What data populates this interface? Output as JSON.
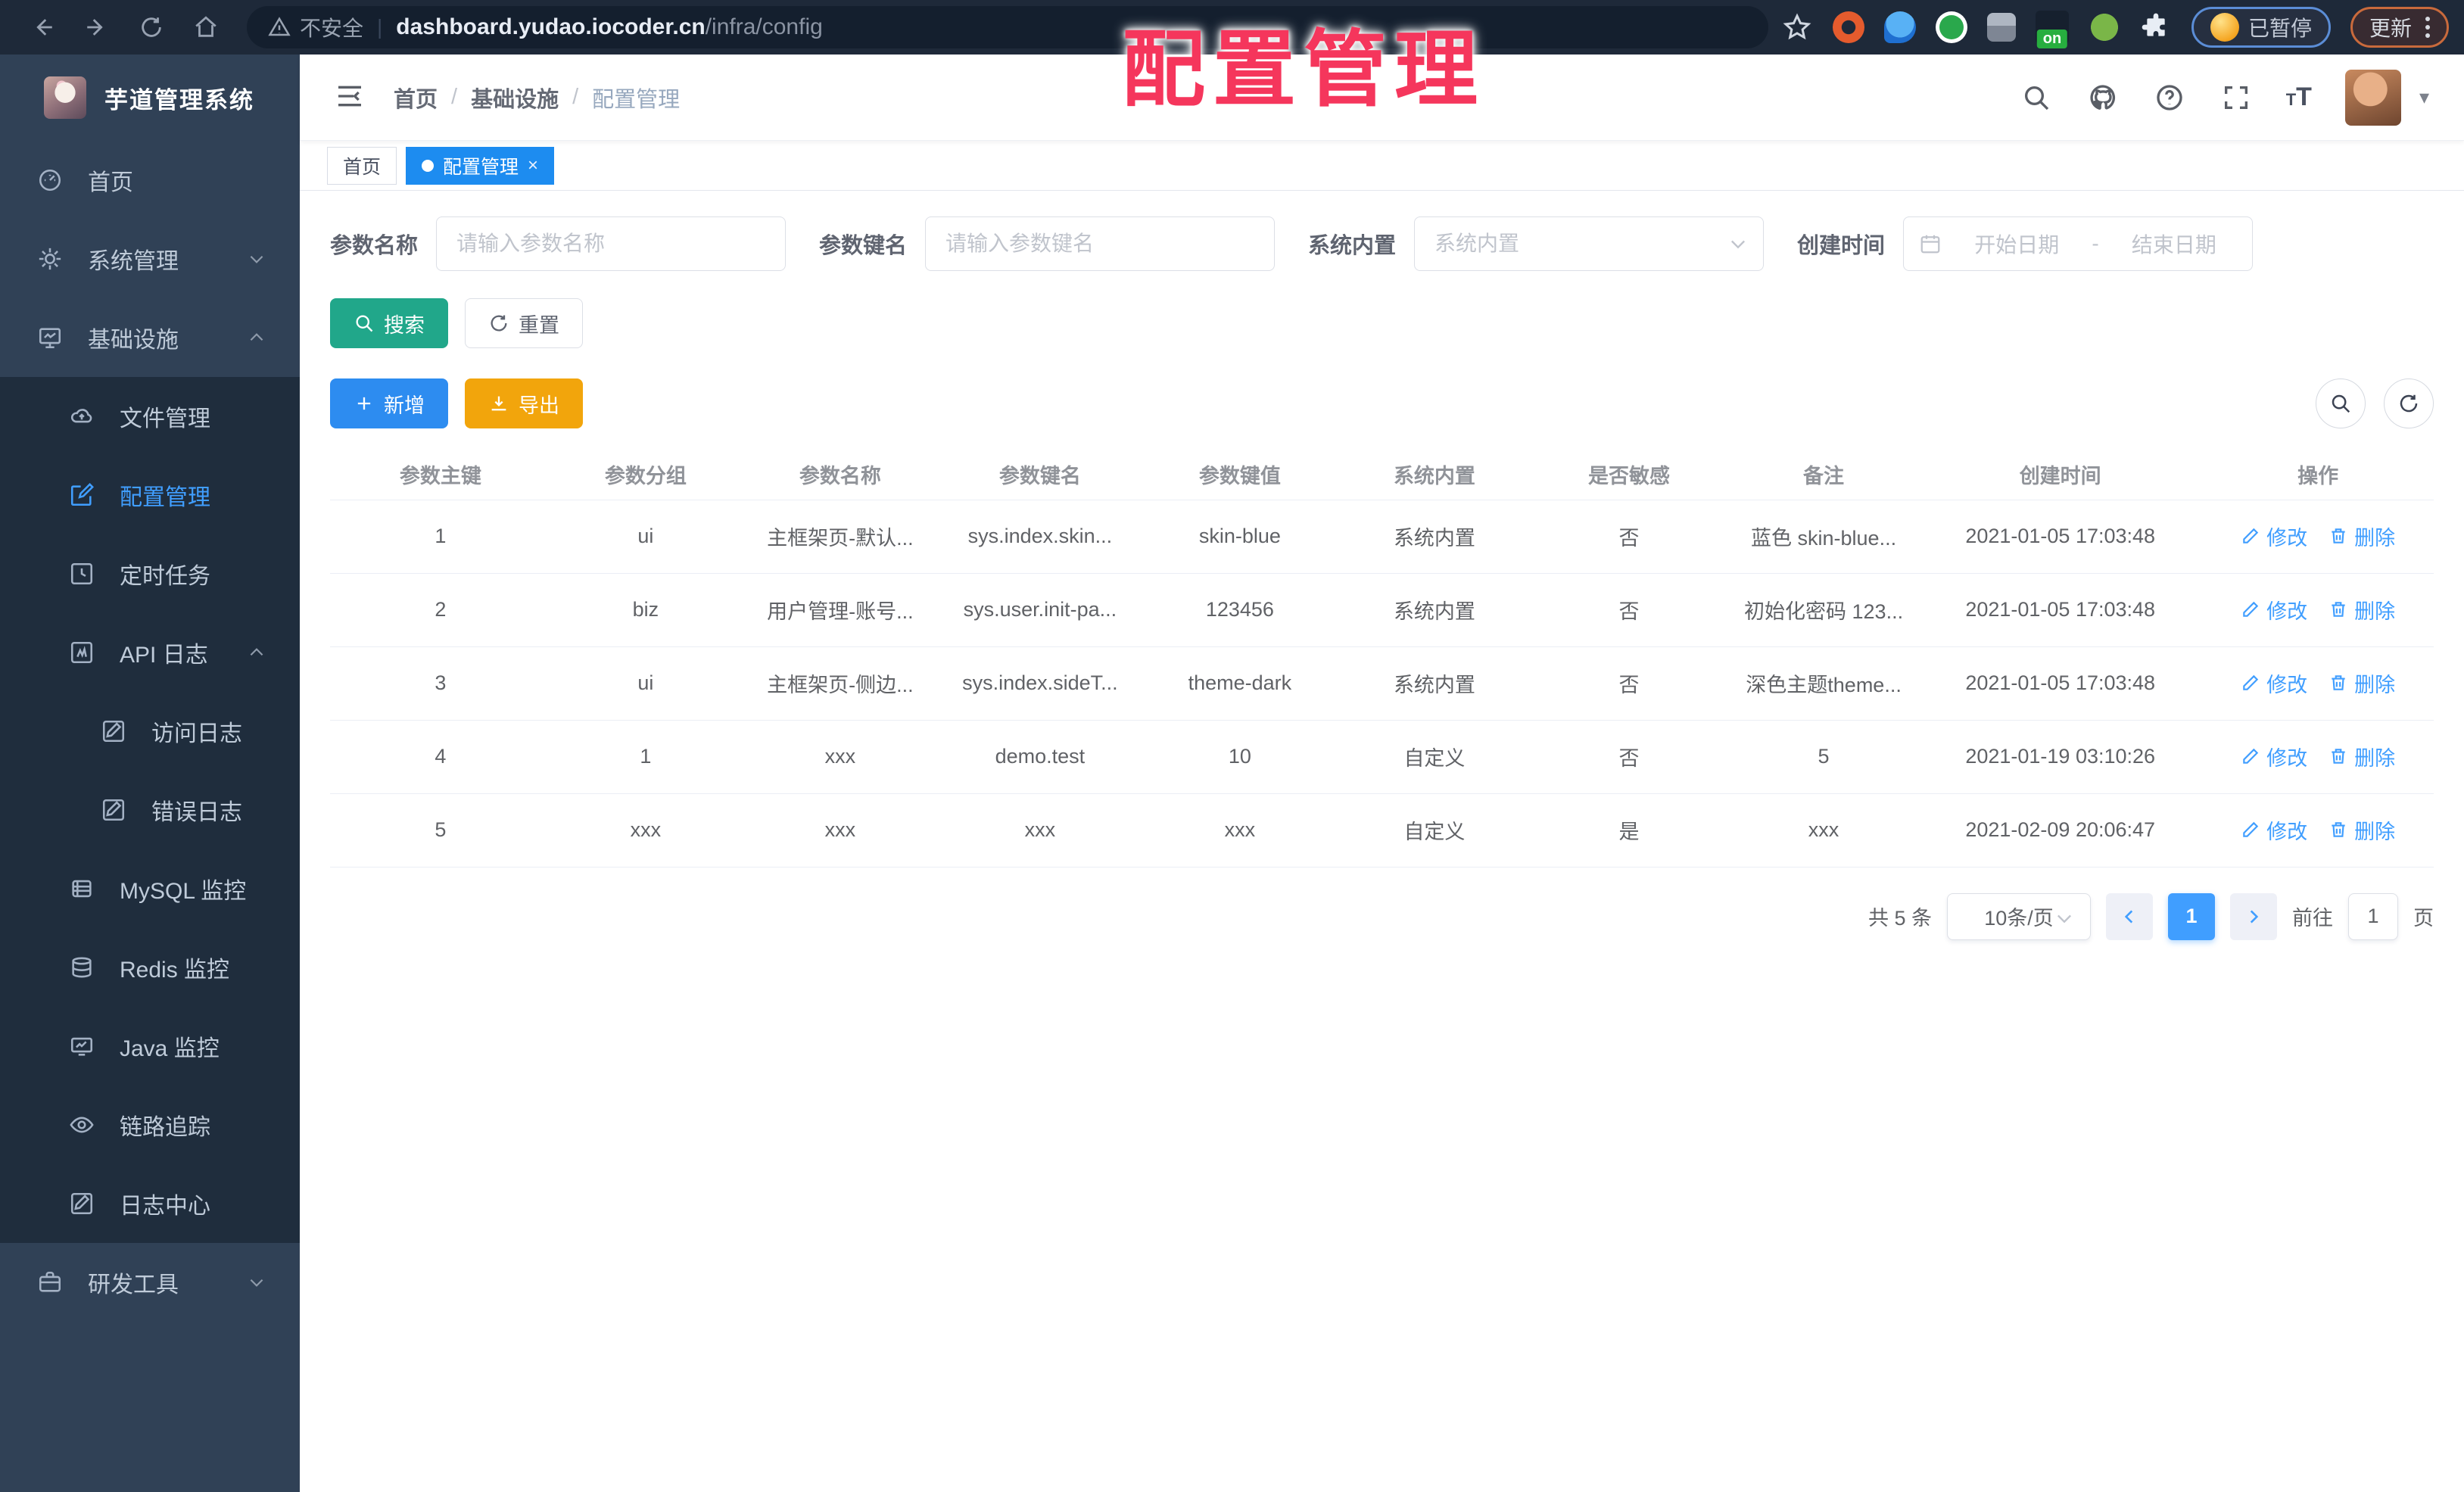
{
  "browser": {
    "security_label": "不安全",
    "url_host": "dashboard.yudao.iocoder.cn",
    "url_path": "/infra/config",
    "extension_badge": "on",
    "paused_label": "已暂停",
    "update_label": "更新"
  },
  "overlay_title": "配置管理",
  "sidebar": {
    "app_title": "芋道管理系统",
    "menu": [
      {
        "label": "首页",
        "icon": "gauge-icon"
      },
      {
        "label": "系统管理",
        "icon": "gear-icon",
        "arrow": "down"
      },
      {
        "label": "基础设施",
        "icon": "monitor-icon",
        "arrow": "up"
      },
      {
        "label": "文件管理",
        "icon": "cloud-icon"
      },
      {
        "label": "配置管理",
        "icon": "edit-square-icon",
        "active": true
      },
      {
        "label": "定时任务",
        "icon": "clock-icon"
      },
      {
        "label": "API 日志",
        "icon": "log-icon",
        "arrow": "up"
      },
      {
        "label": "访问日志",
        "icon": "log-icon"
      },
      {
        "label": "错误日志",
        "icon": "log-icon"
      },
      {
        "label": "MySQL 监控",
        "icon": "database-icon"
      },
      {
        "label": "Redis 监控",
        "icon": "stack-icon"
      },
      {
        "label": "Java 监控",
        "icon": "screen-icon"
      },
      {
        "label": "链路追踪",
        "icon": "eye-icon"
      },
      {
        "label": "日志中心",
        "icon": "log-icon"
      },
      {
        "label": "研发工具",
        "icon": "briefcase-icon",
        "arrow": "down"
      }
    ]
  },
  "topbar": {
    "breadcrumb": [
      "首页",
      "基础设施",
      "配置管理"
    ]
  },
  "tabs": [
    {
      "label": "首页"
    },
    {
      "label": "配置管理",
      "active": true
    }
  ],
  "filters": {
    "name_label": "参数名称",
    "name_placeholder": "请输入参数名称",
    "key_label": "参数键名",
    "key_placeholder": "请输入参数键名",
    "type_label": "系统内置",
    "type_placeholder": "系统内置",
    "date_label": "创建时间",
    "date_start_placeholder": "开始日期",
    "date_separator": "-",
    "date_end_placeholder": "结束日期",
    "search_label": "搜索",
    "reset_label": "重置"
  },
  "toolbar": {
    "add_label": "新增",
    "export_label": "导出"
  },
  "table": {
    "headers": [
      "参数主键",
      "参数分组",
      "参数名称",
      "参数键名",
      "参数键值",
      "系统内置",
      "是否敏感",
      "备注",
      "创建时间",
      "操作"
    ],
    "action_modify": "修改",
    "action_delete": "删除",
    "rows": [
      [
        "1",
        "ui",
        "主框架页-默认...",
        "sys.index.skin...",
        "skin-blue",
        "系统内置",
        "否",
        "蓝色 skin-blue...",
        "2021-01-05 17:03:48"
      ],
      [
        "2",
        "biz",
        "用户管理-账号...",
        "sys.user.init-pa...",
        "123456",
        "系统内置",
        "否",
        "初始化密码 123...",
        "2021-01-05 17:03:48"
      ],
      [
        "3",
        "ui",
        "主框架页-侧边...",
        "sys.index.sideT...",
        "theme-dark",
        "系统内置",
        "否",
        "深色主题theme...",
        "2021-01-05 17:03:48"
      ],
      [
        "4",
        "1",
        "xxx",
        "demo.test",
        "10",
        "自定义",
        "否",
        "5",
        "2021-01-19 03:10:26"
      ],
      [
        "5",
        "xxx",
        "xxx",
        "xxx",
        "xxx",
        "自定义",
        "是",
        "xxx",
        "2021-02-09 20:06:47"
      ]
    ]
  },
  "pagination": {
    "total": "共 5 条",
    "page_size": "10条/页",
    "page": "1",
    "goto_label": "前往",
    "goto_value": "1",
    "page_unit": "页"
  },
  "colors": {
    "accent": "#409eff",
    "active_tab": "#1d8cf0",
    "search_button": "#21a78a",
    "add_button": "#2d8cf0",
    "export_button": "#f2a50c",
    "overlay_title": "#f5365c",
    "sidebar_bg": "#304156",
    "submenu_bg": "#1f2d3d"
  }
}
